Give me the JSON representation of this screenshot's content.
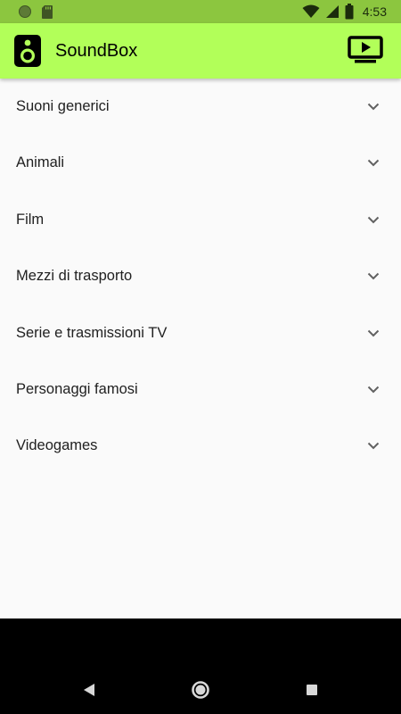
{
  "status_bar": {
    "time": "4:53"
  },
  "app_bar": {
    "title": "SoundBox",
    "logo_icon": "speaker-icon",
    "cast_icon": "cast-play-icon"
  },
  "categories": [
    {
      "label": "Suoni generici"
    },
    {
      "label": "Animali"
    },
    {
      "label": "Film"
    },
    {
      "label": "Mezzi di trasporto"
    },
    {
      "label": "Serie e trasmissioni TV"
    },
    {
      "label": "Personaggi famosi"
    },
    {
      "label": "Videogames"
    }
  ],
  "colors": {
    "status_bar": "#8cc63f",
    "app_bar": "#b2ff59",
    "background": "#fafafa",
    "nav_bar": "#000000"
  },
  "nav": {
    "back_icon": "back-triangle-icon",
    "home_icon": "home-circle-icon",
    "recents_icon": "recents-square-icon"
  }
}
